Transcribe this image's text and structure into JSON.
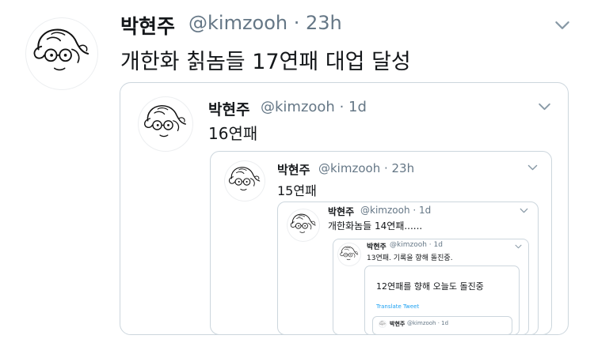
{
  "tweet": {
    "name": "박현주",
    "handle": "@kimzooh · 23h",
    "text": "개한화 칡놈들 17연패 대업 달성"
  },
  "quote1": {
    "name": "박현주",
    "handle": "@kimzooh · 1d",
    "text": "16연패"
  },
  "quote2": {
    "name": "박현주",
    "handle": "@kimzooh · 23h",
    "text": "15연패"
  },
  "quote3": {
    "name": "박현주",
    "handle": "@kimzooh · 1d",
    "text": "개한화놈들 14연패......"
  },
  "quote4": {
    "name": "박현주",
    "handle": "@kimzooh · 1d",
    "text": "13연패. 기록을 향해 돌진중."
  },
  "quote5": {
    "text": "12연패를 향해 오늘도 돌진중",
    "translate_label": "Translate Tweet"
  },
  "quote6": {
    "name": "박현주",
    "handle": "@kimzooh · 1d"
  },
  "icons": {
    "menu": "chevron-down-icon",
    "avatar": "sketch-face-avatar"
  },
  "colors": {
    "text": "#14171a",
    "secondary": "#657786",
    "border": "#ccd6dd",
    "chevron": "#8899a6"
  }
}
